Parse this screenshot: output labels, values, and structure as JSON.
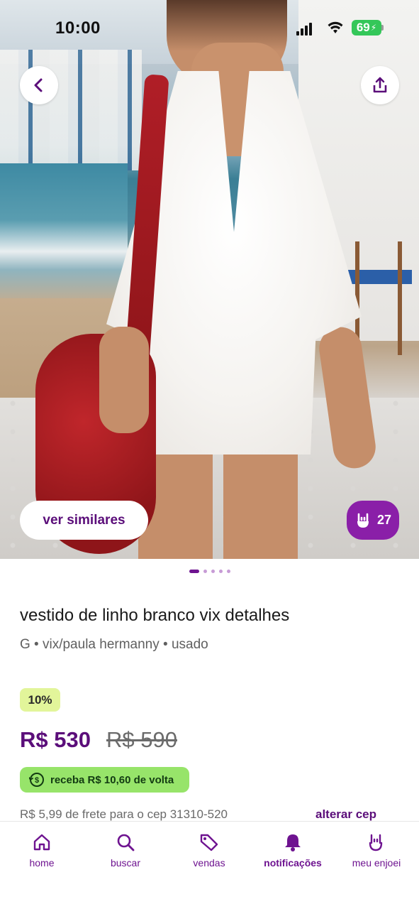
{
  "status_bar": {
    "time": "10:00",
    "battery": "69"
  },
  "hero": {
    "similar_label": "ver similares",
    "likes_count": "27",
    "carousel": {
      "total": 5,
      "active": 1
    }
  },
  "product": {
    "title": "vestido de linho branco vix detalhes",
    "meta": "G • vix/paula hermanny • usado",
    "discount": "10%",
    "price": "R$ 530",
    "old_price": "R$ 590",
    "cashback": "receba R$ 10,60 de volta",
    "freight": "R$ 5,99 de frete para o cep 31310-520",
    "change_cep": "alterar cep"
  },
  "nav": {
    "items": [
      {
        "label": "home",
        "icon": "home-icon"
      },
      {
        "label": "buscar",
        "icon": "search-icon"
      },
      {
        "label": "vendas",
        "icon": "tag-icon"
      },
      {
        "label": "notificações",
        "icon": "bell-icon",
        "active": true
      },
      {
        "label": "meu enjoei",
        "icon": "rock-hand-icon"
      }
    ]
  },
  "colors": {
    "brand_purple": "#5b0e7a",
    "accent_purple": "#8a1fa8",
    "discount_bg": "#e2f59a",
    "cashback_bg": "#97e46a"
  }
}
